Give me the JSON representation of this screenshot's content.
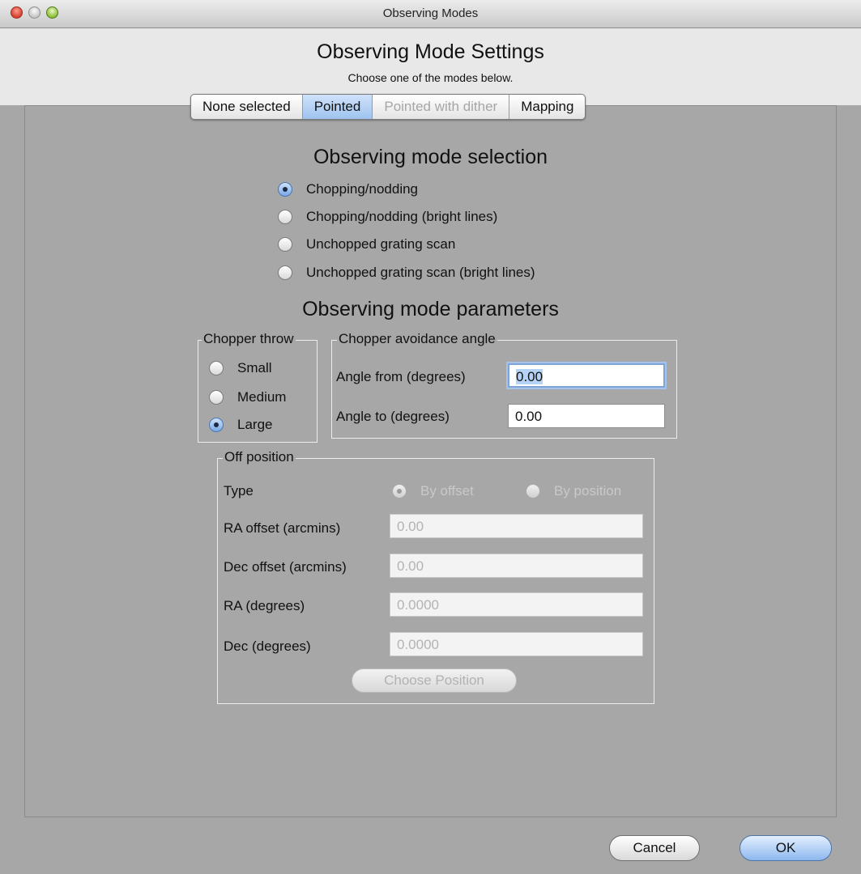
{
  "window": {
    "title": "Observing Modes"
  },
  "header": {
    "title": "Observing Mode Settings",
    "subtitle": "Choose one of the modes below."
  },
  "tabs": [
    {
      "label": "None selected",
      "state": "normal"
    },
    {
      "label": "Pointed",
      "state": "selected"
    },
    {
      "label": "Pointed with dither",
      "state": "disabled"
    },
    {
      "label": "Mapping",
      "state": "normal"
    }
  ],
  "mode_selection": {
    "heading": "Observing mode selection",
    "options": [
      {
        "label": "Chopping/nodding",
        "checked": true
      },
      {
        "label": "Chopping/nodding (bright lines)",
        "checked": false
      },
      {
        "label": "Unchopped grating scan",
        "checked": false
      },
      {
        "label": "Unchopped grating scan (bright lines)",
        "checked": false
      }
    ]
  },
  "parameters": {
    "heading": "Observing mode parameters",
    "chopper_throw": {
      "legend": "Chopper throw",
      "options": [
        {
          "label": "Small",
          "checked": false
        },
        {
          "label": "Medium",
          "checked": false
        },
        {
          "label": "Large",
          "checked": true
        }
      ]
    },
    "avoidance": {
      "legend": "Chopper avoidance angle",
      "angle_from_label": "Angle from (degrees)",
      "angle_from_value": "0.00",
      "angle_to_label": "Angle to (degrees)",
      "angle_to_value": "0.00"
    },
    "off_position": {
      "legend": "Off position",
      "type_label": "Type",
      "type_options": [
        {
          "label": "By offset",
          "checked": true
        },
        {
          "label": "By position",
          "checked": false
        }
      ],
      "ra_offset_label": "RA offset (arcmins)",
      "ra_offset_value": "0.00",
      "dec_offset_label": "Dec offset (arcmins)",
      "dec_offset_value": "0.00",
      "ra_label": "RA (degrees)",
      "ra_value": "0.0000",
      "dec_label": "Dec (degrees)",
      "dec_value": "0.0000",
      "choose_button": "Choose Position"
    }
  },
  "footer": {
    "cancel": "Cancel",
    "ok": "OK"
  }
}
